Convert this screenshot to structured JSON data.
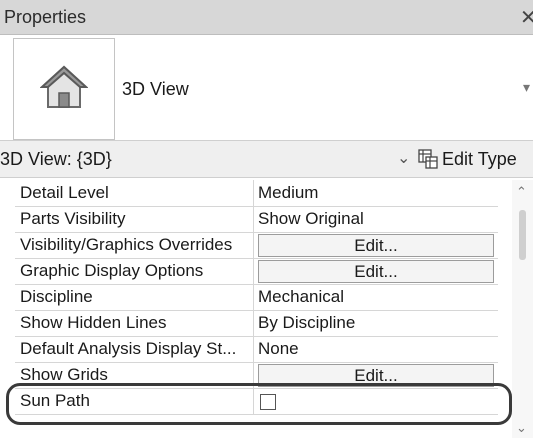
{
  "titlebar": {
    "title": "Properties",
    "close_glyph": "✕"
  },
  "type_selector": {
    "type_name": "3D View",
    "thumbnail_icon": "house-icon",
    "dropdown_glyph": "▾"
  },
  "instance_bar": {
    "selection": "3D View: {3D}",
    "chevron_glyph": "⌄",
    "edit_type_label": "Edit Type"
  },
  "properties": [
    {
      "name": "Detail Level",
      "kind": "text",
      "value": "Medium"
    },
    {
      "name": "Parts Visibility",
      "kind": "text",
      "value": "Show Original"
    },
    {
      "name": "Visibility/Graphics Overrides",
      "kind": "button",
      "value": "Edit..."
    },
    {
      "name": "Graphic Display Options",
      "kind": "button",
      "value": "Edit..."
    },
    {
      "name": "Discipline",
      "kind": "text",
      "value": "Mechanical"
    },
    {
      "name": "Show Hidden Lines",
      "kind": "text",
      "value": "By Discipline"
    },
    {
      "name": "Default Analysis Display St...",
      "kind": "text",
      "value": "None"
    },
    {
      "name": "Show Grids",
      "kind": "button",
      "value": "Edit..."
    },
    {
      "name": "Sun Path",
      "kind": "checkbox",
      "value": ""
    }
  ],
  "scrollbar": {
    "up_glyph": "⌃",
    "down_glyph": "⌄"
  },
  "colors": {
    "titlebar_bg": "#d7d7d7",
    "instance_bar_bg": "#efefef",
    "highlight_outline": "#3a3a3a"
  }
}
